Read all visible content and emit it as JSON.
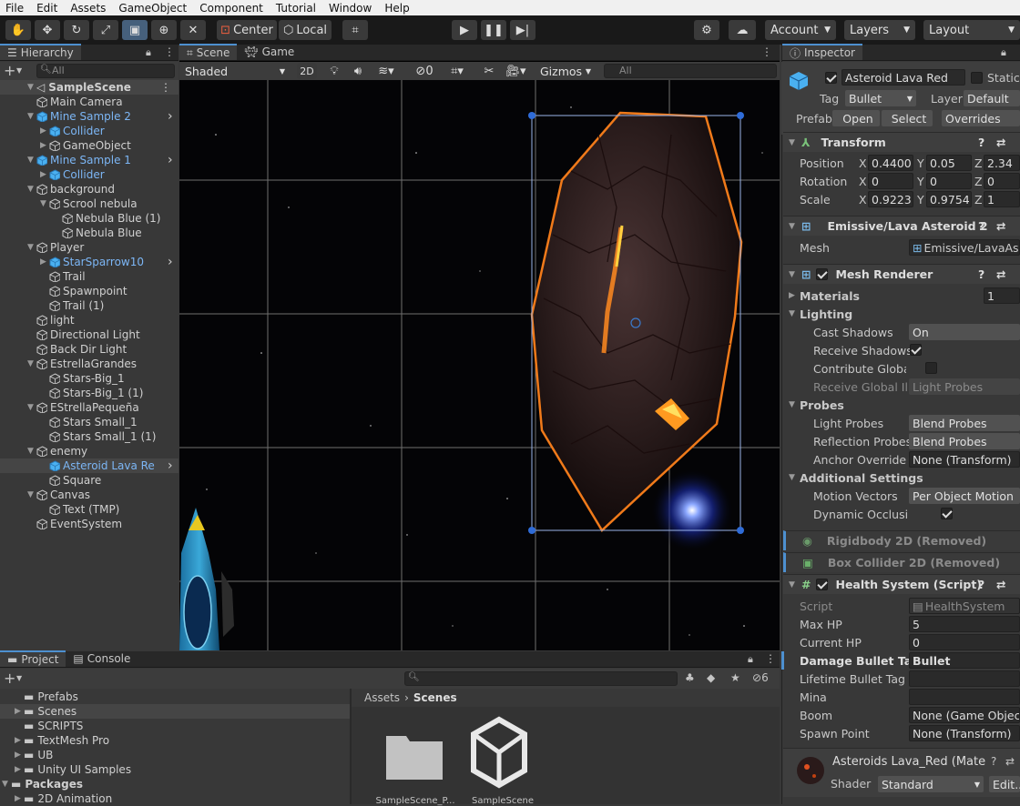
{
  "menu": [
    "File",
    "Edit",
    "Assets",
    "GameObject",
    "Component",
    "Tutorial",
    "Window",
    "Help"
  ],
  "toolbar": {
    "center": "Center",
    "local": "Local",
    "account": "Account",
    "layers": "Layers",
    "layout": "Layout"
  },
  "hierarchy": {
    "tab": "Hierarchy",
    "search_placeholder": "All",
    "scene": "SampleScene",
    "items": [
      {
        "label": "Main Camera",
        "depth": 1,
        "fold": "",
        "prefab": false
      },
      {
        "label": "Mine Sample 2",
        "depth": 1,
        "fold": "▼",
        "prefab": true,
        "arrow": true
      },
      {
        "label": "Collider",
        "depth": 2,
        "fold": "▶",
        "prefab": true
      },
      {
        "label": "GameObject",
        "depth": 2,
        "fold": "▶",
        "prefab": false
      },
      {
        "label": "Mine Sample 1",
        "depth": 1,
        "fold": "▼",
        "prefab": true,
        "arrow": true
      },
      {
        "label": "Collider",
        "depth": 2,
        "fold": "▶",
        "prefab": true
      },
      {
        "label": "background",
        "depth": 1,
        "fold": "▼",
        "prefab": false
      },
      {
        "label": "Scrool nebula",
        "depth": 2,
        "fold": "▼",
        "prefab": false
      },
      {
        "label": "Nebula Blue (1)",
        "depth": 3,
        "fold": "",
        "prefab": false
      },
      {
        "label": "Nebula Blue",
        "depth": 3,
        "fold": "",
        "prefab": false
      },
      {
        "label": "Player",
        "depth": 1,
        "fold": "▼",
        "prefab": false
      },
      {
        "label": "StarSparrow10",
        "depth": 2,
        "fold": "▶",
        "prefab": true,
        "arrow": true
      },
      {
        "label": "Trail",
        "depth": 2,
        "fold": "",
        "prefab": false
      },
      {
        "label": "Spawnpoint",
        "depth": 2,
        "fold": "",
        "prefab": false
      },
      {
        "label": "Trail (1)",
        "depth": 2,
        "fold": "",
        "prefab": false
      },
      {
        "label": "light",
        "depth": 1,
        "fold": "",
        "prefab": false
      },
      {
        "label": "Directional Light",
        "depth": 1,
        "fold": "",
        "prefab": false
      },
      {
        "label": "Back Dir Light",
        "depth": 1,
        "fold": "",
        "prefab": false
      },
      {
        "label": "EstrellaGrandes",
        "depth": 1,
        "fold": "▼",
        "prefab": false
      },
      {
        "label": "Stars-Big_1",
        "depth": 2,
        "fold": "",
        "prefab": false
      },
      {
        "label": "Stars-Big_1 (1)",
        "depth": 2,
        "fold": "",
        "prefab": false
      },
      {
        "label": "EStrellaPequeña",
        "depth": 1,
        "fold": "▼",
        "prefab": false
      },
      {
        "label": "Stars Small_1",
        "depth": 2,
        "fold": "",
        "prefab": false
      },
      {
        "label": "Stars Small_1 (1)",
        "depth": 2,
        "fold": "",
        "prefab": false
      },
      {
        "label": "enemy",
        "depth": 1,
        "fold": "▼",
        "prefab": false
      },
      {
        "label": "Asteroid Lava Re",
        "depth": 2,
        "fold": "",
        "prefab": true,
        "arrow": true,
        "selected": true
      },
      {
        "label": "Square",
        "depth": 2,
        "fold": "",
        "prefab": false
      },
      {
        "label": "Canvas",
        "depth": 1,
        "fold": "▼",
        "prefab": false
      },
      {
        "label": "Text (TMP)",
        "depth": 2,
        "fold": "",
        "prefab": false
      },
      {
        "label": "EventSystem",
        "depth": 1,
        "fold": "",
        "prefab": false
      }
    ]
  },
  "scene": {
    "tab_scene": "Scene",
    "tab_game": "Game",
    "shading": "Shaded",
    "mode": "2D",
    "hidden_count": "0",
    "gizmos": "Gizmos",
    "search_placeholder": "All"
  },
  "project": {
    "tab_project": "Project",
    "tab_console": "Console",
    "count": "6",
    "folders": [
      {
        "label": "Prefabs",
        "fold": ""
      },
      {
        "label": "Scenes",
        "fold": "▶",
        "selected": true
      },
      {
        "label": "SCRIPTS",
        "fold": ""
      },
      {
        "label": "TextMesh Pro",
        "fold": "▶"
      },
      {
        "label": "UB",
        "fold": "▶"
      },
      {
        "label": "Unity UI Samples",
        "fold": "▶"
      }
    ],
    "packages": "Packages",
    "pkg_first": "2D Animation",
    "breadcrumb_root": "Assets",
    "breadcrumb_current": "Scenes",
    "assets": [
      "SampleScene_P...",
      "SampleScene"
    ]
  },
  "inspector": {
    "tab": "Inspector",
    "object_name": "Asteroid Lava Red",
    "static": "Static",
    "tag_label": "Tag",
    "tag": "Bullet",
    "layer_label": "Layer",
    "layer": "Default",
    "prefab_label": "Prefab",
    "open": "Open",
    "select": "Select",
    "overrides": "Overrides",
    "transform": {
      "title": "Transform",
      "position": "Position",
      "rotation": "Rotation",
      "scale": "Scale",
      "pos": {
        "x": "0.4400",
        "y": "0.05",
        "z": "2.34"
      },
      "rot": {
        "x": "0",
        "y": "0",
        "z": "0"
      },
      "scl": {
        "x": "0.9223",
        "y": "0.9754",
        "z": "1"
      }
    },
    "meshfilter": {
      "title": "Emissive/Lava Asteroid 2",
      "mesh_label": "Mesh",
      "mesh": "Emissive/LavaAs"
    },
    "renderer": {
      "title": "Mesh Renderer",
      "materials": "Materials",
      "materials_count": "1",
      "lighting": "Lighting",
      "cast_shadows": "Cast Shadows",
      "cast_val": "On",
      "receive_shadows": "Receive Shadows",
      "contribute_gi": "Contribute Global I",
      "receive_gi": "Receive Global Illu",
      "receive_gi_val": "Light Probes",
      "probes": "Probes",
      "light_probes": "Light Probes",
      "light_probes_val": "Blend Probes",
      "reflection_probes": "Reflection Probes",
      "reflection_val": "Blend Probes",
      "anchor": "Anchor Override",
      "anchor_val": "None (Transform)",
      "additional": "Additional Settings",
      "motion": "Motion Vectors",
      "motion_val": "Per Object Motion",
      "dynamic_occ": "Dynamic Occlusio"
    },
    "rigidbody": "Rigidbody 2D (Removed)",
    "boxcollider": "Box Collider 2D (Removed)",
    "health": {
      "title": "Health System (Script)",
      "script_label": "Script",
      "script": "HealthSystem",
      "maxhp_label": "Max HP",
      "maxhp": "5",
      "curhp_label": "Current HP",
      "curhp": "0",
      "dmg_label": "Damage Bullet Tag",
      "dmg": "Bullet",
      "life_label": "Lifetime Bullet Tag",
      "life": "",
      "mina_label": "Mina",
      "mina": "",
      "boom_label": "Boom",
      "boom": "None (Game Object)",
      "spawn_label": "Spawn Point",
      "spawn": "None (Transform)"
    },
    "material": {
      "name": "Asteroids Lava_Red (Mate",
      "shader_label": "Shader",
      "shader": "Standard",
      "edit": "Edit..."
    }
  },
  "colors": {
    "accent": "#4d90d0",
    "selection": "#2c5d87",
    "prefab_blue": "#7cb6f5",
    "orange": "#f07a1a"
  }
}
